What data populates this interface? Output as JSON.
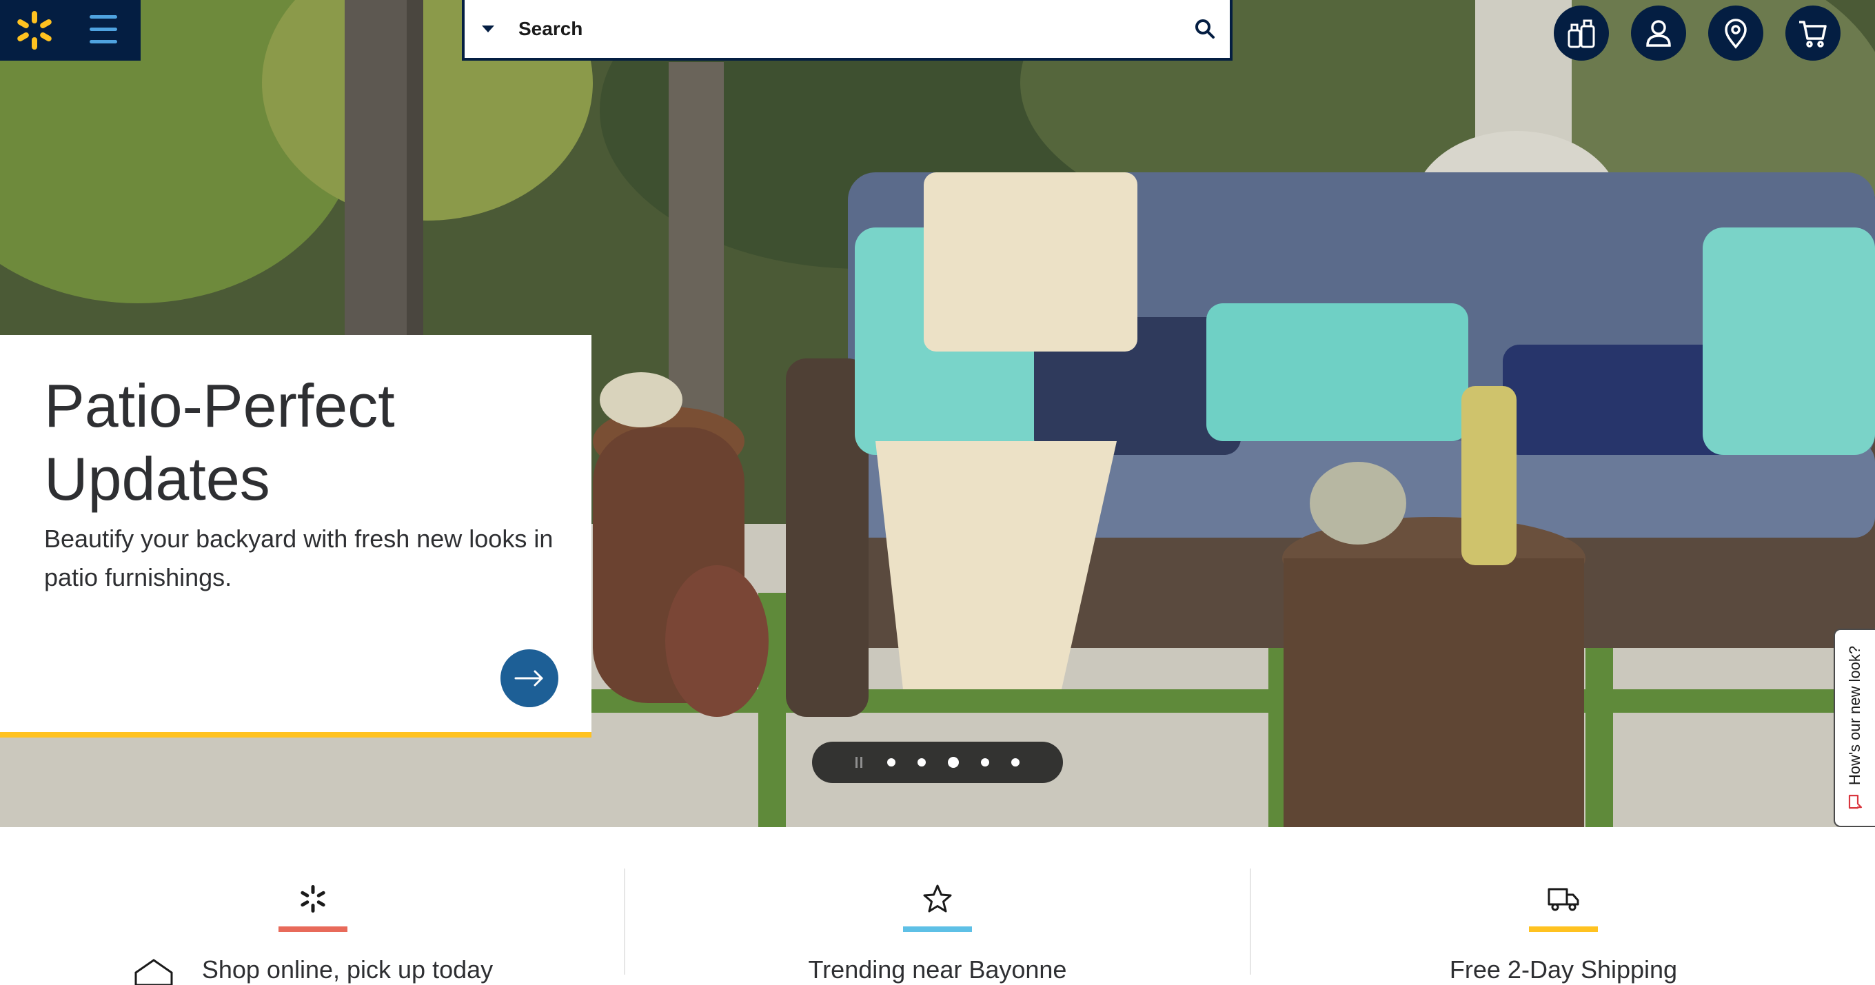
{
  "header": {
    "logo_alt": "Walmart",
    "menu_icon": "hamburger-menu-icon",
    "search": {
      "placeholder": "Search",
      "value": "",
      "department_icon": "caret-down-icon",
      "button_icon": "search-icon"
    },
    "icons": [
      {
        "name": "lists-icon"
      },
      {
        "name": "account-icon"
      },
      {
        "name": "store-location-icon"
      },
      {
        "name": "cart-icon"
      }
    ]
  },
  "hero": {
    "title": "Patio-Perfect Updates",
    "subtitle": "Beautify your backyard with fresh new looks in patio furnishings.",
    "cta_icon": "arrow-right-icon",
    "carousel": {
      "slide_count": 5,
      "active_index": 2,
      "pause_icon": "pause-icon"
    }
  },
  "feedback_tab": {
    "label": "How's our new look?",
    "icon": "chat-bubble-icon"
  },
  "value_props": [
    {
      "label": "Shop online, pick up today",
      "icon": "spark-icon",
      "bar_color": "#e86a5a"
    },
    {
      "label": "Trending near Bayonne",
      "icon": "star-icon",
      "bar_color": "#5ec0e6"
    },
    {
      "label": "Free 2-Day Shipping",
      "icon": "truck-icon",
      "bar_color": "#ffc220"
    }
  ],
  "colors": {
    "brand_navy": "#041e42",
    "spark_yellow": "#ffc220",
    "menu_blue": "#4fa3e0",
    "cta_blue": "#1d5f96"
  }
}
